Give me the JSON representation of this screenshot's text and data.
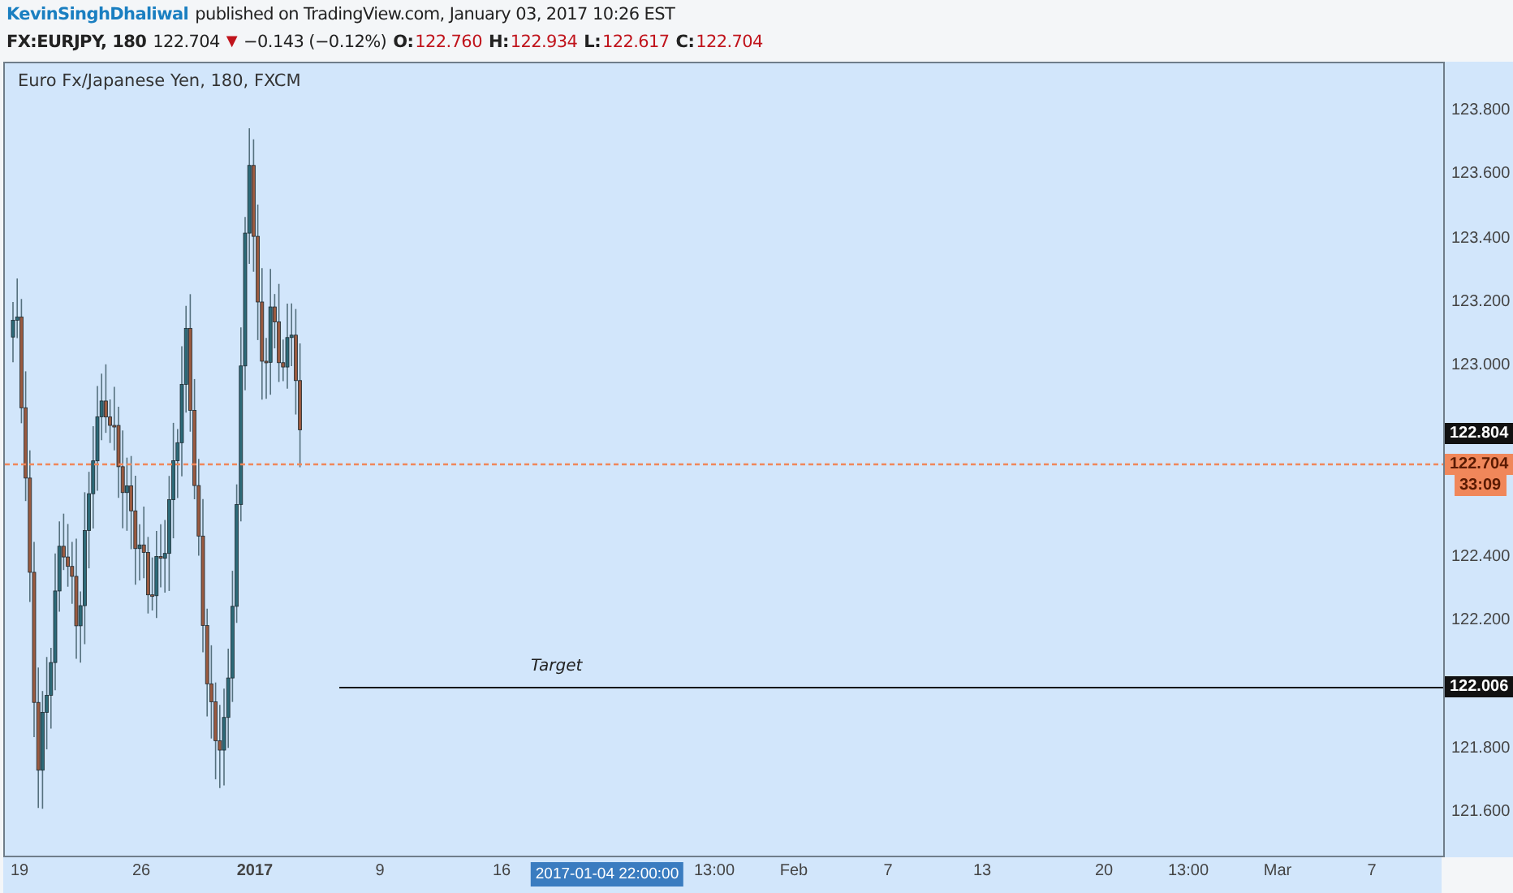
{
  "header": {
    "author": "KevinSinghDhaliwal",
    "published_text": "published on TradingView.com, January 03, 2017 10:26 EST"
  },
  "quote": {
    "symbol": "FX:EURJPY, 180",
    "last": "122.704",
    "arrow": "▼",
    "change": "−0.143 (−0.12%)",
    "ohlc": [
      {
        "label": "O:",
        "value": "122.760"
      },
      {
        "label": "H:",
        "value": "122.934"
      },
      {
        "label": "L:",
        "value": "122.617"
      },
      {
        "label": "C:",
        "value": "122.704"
      }
    ]
  },
  "chart": {
    "legend": "Euro Fx/Japanese Yen, 180, FXCM",
    "annotation": "Target"
  },
  "price_axis": {
    "tick_groups": [
      [
        "123.800",
        "123.600",
        "123.400",
        "123.200",
        "123.000"
      ],
      [
        "122.400",
        "122.200"
      ],
      [
        "121.800",
        "121.600"
      ]
    ],
    "tags": [
      {
        "kind": "marker",
        "text": "122.804"
      },
      {
        "kind": "last",
        "text": "122.704"
      },
      {
        "kind": "countdown",
        "text": "33:09"
      },
      {
        "kind": "marker",
        "text": "122.006"
      }
    ]
  },
  "time_axis": [
    {
      "text": "19",
      "bold": false,
      "selected": false
    },
    {
      "text": "26",
      "bold": false,
      "selected": false
    },
    {
      "text": "2017",
      "bold": true,
      "selected": false
    },
    {
      "text": "9",
      "bold": false,
      "selected": false
    },
    {
      "text": "16",
      "bold": false,
      "selected": false
    },
    {
      "text": "2017-01-04 22:00:00",
      "bold": false,
      "selected": true
    },
    {
      "text": "13:00",
      "bold": false,
      "selected": false
    },
    {
      "text": "Feb",
      "bold": false,
      "selected": false
    },
    {
      "text": "7",
      "bold": false,
      "selected": false
    },
    {
      "text": "13",
      "bold": false,
      "selected": false
    },
    {
      "text": "20",
      "bold": false,
      "selected": false
    },
    {
      "text": "13:00",
      "bold": false,
      "selected": false
    },
    {
      "text": "Mar",
      "bold": false,
      "selected": false
    },
    {
      "text": "7",
      "bold": false,
      "selected": false
    }
  ]
}
